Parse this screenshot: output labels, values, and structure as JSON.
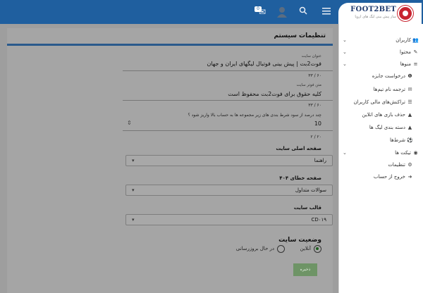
{
  "brand": {
    "logo_text": "FOOT2BET",
    "logo_sub": "ساز پیش بینی لیگ های اروپا"
  },
  "topbar": {
    "notification_count": "0"
  },
  "sidebar": {
    "items": [
      {
        "label": "کاربران",
        "icon": "users-icon",
        "glyph": "👥",
        "has_chevron": true
      },
      {
        "label": "محتوا",
        "icon": "pencil-icon",
        "glyph": "✎",
        "has_chevron": true
      },
      {
        "label": "منوها",
        "icon": "menu-icon",
        "glyph": "≡",
        "has_chevron": true
      },
      {
        "label": "درخواست جایزه",
        "icon": "gift-icon",
        "glyph": "❶",
        "has_chevron": false
      },
      {
        "label": "ترجمه نام تیم‌ها",
        "icon": "mail-icon",
        "glyph": "✉",
        "has_chevron": false
      },
      {
        "label": "تراکنش‌های مالی کاربران",
        "icon": "list-icon",
        "glyph": "☰",
        "has_chevron": false
      },
      {
        "label": "حذف بازی های اتلاین",
        "icon": "warning-icon",
        "glyph": "▲",
        "has_chevron": false
      },
      {
        "label": "دسته بندی لیگ ها",
        "icon": "warning-icon",
        "glyph": "▲",
        "has_chevron": false
      },
      {
        "label": "شرط‌ها",
        "icon": "soccer-icon",
        "glyph": "⚽",
        "has_chevron": false
      },
      {
        "label": "تیکت ها",
        "icon": "ticket-icon",
        "glyph": "◉",
        "has_chevron": true
      },
      {
        "label": "تنظیمات",
        "icon": "gears-icon",
        "glyph": "⚙",
        "has_chevron": false
      },
      {
        "label": "خروج از حساب",
        "icon": "logout-icon",
        "glyph": "➜",
        "has_chevron": false
      }
    ]
  },
  "settings": {
    "title": "تنظیمات سیستم",
    "site_title_label": "عنوان سایت",
    "site_title_value": "فوت‌2بت | پیش بینی فوتبال لیگهای ایران و جهان",
    "site_title_counter": "۳۳ / ۶۰",
    "footer_label": "متن فوتر سایت",
    "footer_value": "کلیه حقوق برای فوت‌2بت محفوظ است",
    "footer_counter": "۳۳ / ۶۰",
    "percent_hint": "چند درصد از سود شرط بندی های زیر مجموعه ها به حساب بالا واریز شود ؟",
    "percent_value": "10",
    "percent_counter": "۲ / ۲۰",
    "homepage_label": "صفحه اصلی سایت",
    "homepage_value": "راهنما",
    "error404_label": "صفحه خطای ۴۰۴",
    "error404_value": "سوالات متداول",
    "template_label": "قالب سایت",
    "template_value": "CD۰۱۹",
    "status_title": "وضعیت سایت",
    "status_online": "آنلاین",
    "status_maintenance": "در حال بروزرسانی",
    "save_label": "ذخیره"
  },
  "colors": {
    "topbar": "#1f5f9f",
    "panel_rule": "#2a5a8c",
    "save": "#6e9466"
  }
}
